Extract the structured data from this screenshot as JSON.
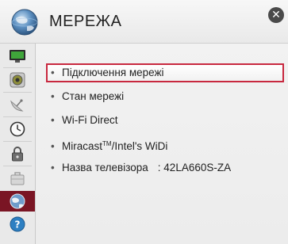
{
  "header": {
    "title": "МЕРЕЖА",
    "close_icon": "close-icon"
  },
  "sidebar": {
    "items": [
      {
        "icon": "tv-icon"
      },
      {
        "icon": "speaker-icon"
      },
      {
        "icon": "satellite-dish-icon"
      },
      {
        "icon": "clock-icon"
      },
      {
        "icon": "lock-icon"
      },
      {
        "icon": "suitcase-icon"
      },
      {
        "icon": "globe-icon",
        "active": true
      },
      {
        "icon": "help-icon"
      }
    ]
  },
  "menu": {
    "items": [
      {
        "label": "Підключення мережі"
      },
      {
        "label": "Стан мережі"
      },
      {
        "label": "Wi-Fi Direct"
      },
      {
        "label_prefix": "Miracast",
        "label_sup": "TM",
        "label_suffix": "/Intel's WiDi"
      },
      {
        "label": "Назва телевізора",
        "value": ": 42LA660S-ZA"
      }
    ]
  },
  "colors": {
    "accent": "#c8283f",
    "active_sidebar": "#7a1524"
  }
}
